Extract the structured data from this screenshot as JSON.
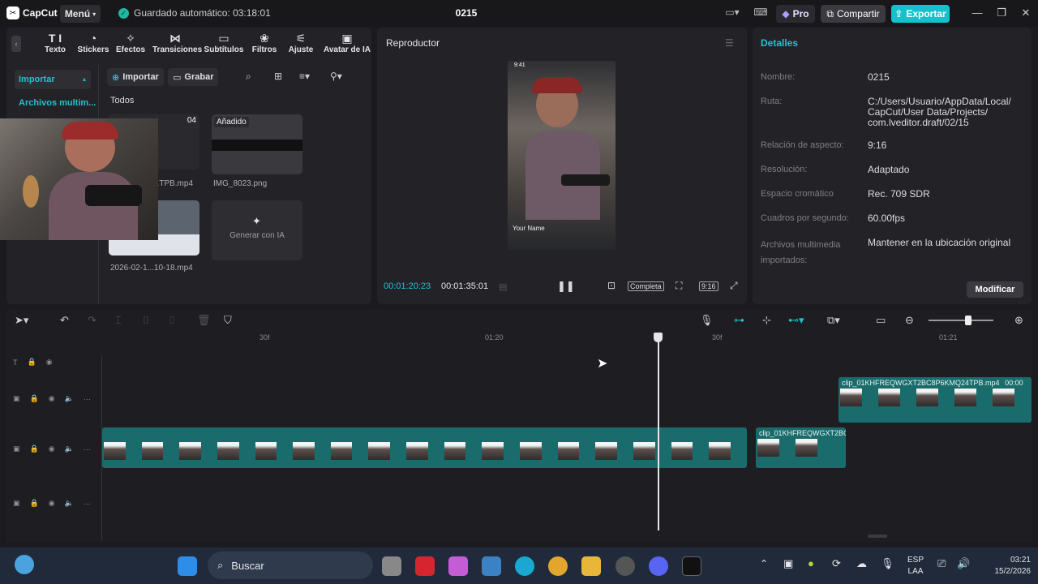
{
  "titlebar": {
    "app_name": "CapCut",
    "menu_label": "Menú",
    "autosave": "Guardado automático: 03:18:01",
    "project_title": "0215",
    "pro_label": "Pro",
    "share_label": "Compartir",
    "export_label": "Exportar"
  },
  "media_tools": [
    {
      "label": "Texto",
      "icon": "text-icon"
    },
    {
      "label": "Stickers",
      "icon": "sticker-icon"
    },
    {
      "label": "Efectos",
      "icon": "effects-icon"
    },
    {
      "label": "Transiciones",
      "icon": "transitions-icon"
    },
    {
      "label": "Subtítulos",
      "icon": "subtitles-icon"
    },
    {
      "label": "Filtros",
      "icon": "filters-icon"
    },
    {
      "label": "Ajuste",
      "icon": "adjust-icon"
    },
    {
      "label": "Avatar de IA",
      "icon": "avatar-icon"
    }
  ],
  "media": {
    "sidebar_import": "Importar",
    "sidebar_archivos": "Archivos multim...",
    "import_btn": "Importar",
    "record_btn": "Grabar",
    "todos": "Todos",
    "items": [
      {
        "label": "...TPB.mp4",
        "time": "04"
      },
      {
        "label": "IMG_8023.png",
        "badge": "Añadido"
      },
      {
        "label": "2026-02-1...10-18.mp4"
      },
      {
        "label": "Generar con IA"
      }
    ]
  },
  "player": {
    "title": "Reproductor",
    "current_time": "00:01:20:23",
    "total_time": "00:01:35:01",
    "full_label": "Completa",
    "ratio_label": "9:16",
    "phone_time": "9:41",
    "phone_name": "Your Name"
  },
  "details": {
    "title": "Detalles",
    "rows": [
      {
        "label": "Nombre:",
        "value": "0215"
      },
      {
        "label": "Ruta:",
        "value": "C:/Users/Usuario/AppData/Local/ CapCut/User Data/Projects/ com.lveditor.draft/02/15"
      },
      {
        "label": "Relación de aspecto:",
        "value": "9:16"
      },
      {
        "label": "Resolución:",
        "value": "Adaptado"
      },
      {
        "label": "Espacio cromático",
        "value": "Rec. 709 SDR"
      },
      {
        "label": "Cuadros por segundo:",
        "value": "60.00fps"
      },
      {
        "label": "Archivos multimedia importados:",
        "value": "Mantener en la ubicación original"
      }
    ],
    "modify_label": "Modificar"
  },
  "timeline": {
    "ruler": [
      "30f",
      "01:20",
      "30f",
      "01:21"
    ],
    "clip_upper": "clip_01KHFREQWGXT2BC8P6KMQ24TPB.mp4",
    "clip_upper_time": "00:00",
    "clip_right": "clip_01KHFREQWGXT2BC"
  },
  "taskbar": {
    "search": "Buscar",
    "lang": "ESP",
    "lang2": "LAA",
    "time": "03:21",
    "date": "15/2/2026"
  }
}
